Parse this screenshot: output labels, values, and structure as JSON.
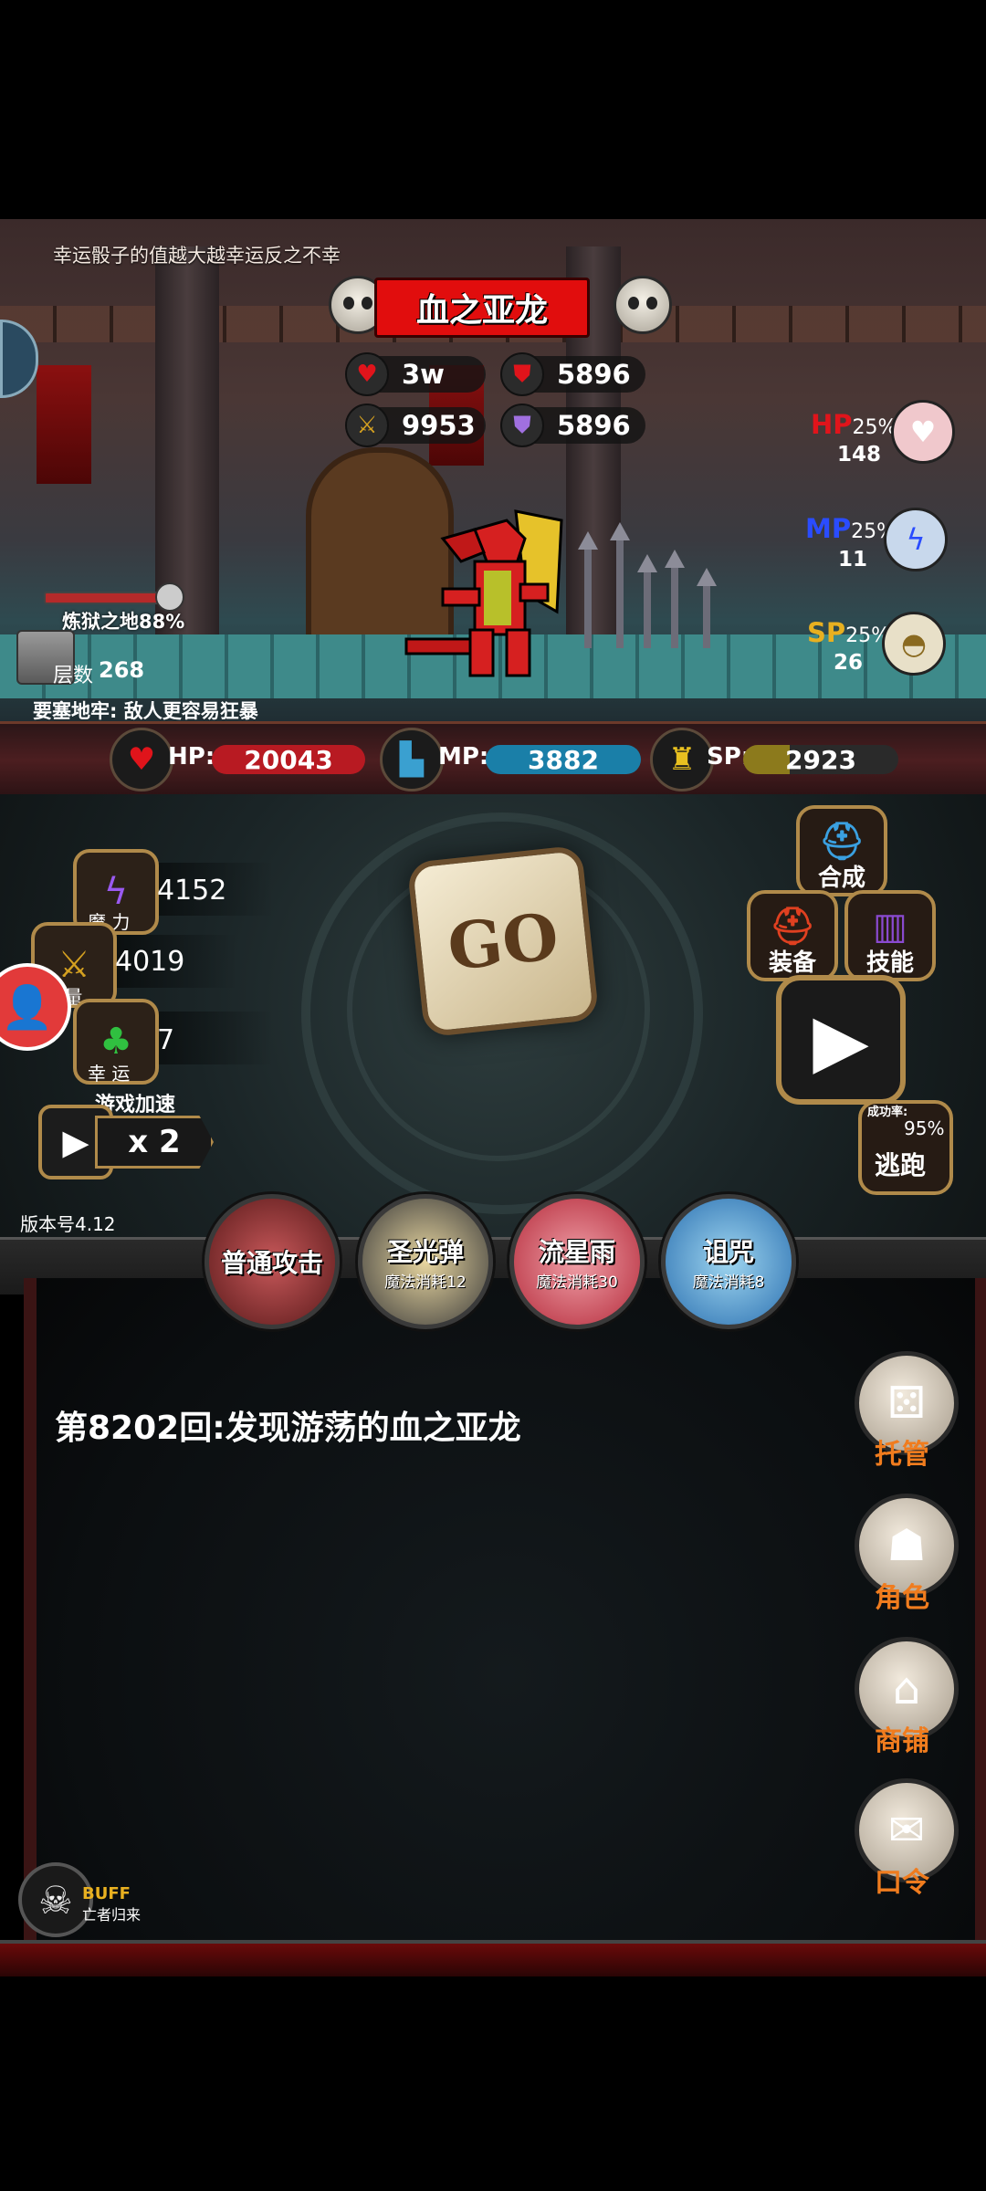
{
  "battle": {
    "tip": "幸运骰子的值越大越幸运反之不幸",
    "boss_name": "血之亚龙",
    "enemy_stats": {
      "hp": "3w",
      "defense": "5896",
      "attack": "9953",
      "magic_defense": "5896"
    },
    "floor": {
      "name": "炼狱之地88%",
      "count_label": "层数",
      "count": "268",
      "progress": 0.88
    },
    "fortress_note": "要塞地牢: 敌人更容易狂暴"
  },
  "potions": [
    {
      "label": "HP",
      "pct": "25%",
      "count": "148",
      "color": "#e0141b",
      "icon": "potion-heart-icon"
    },
    {
      "label": "MP",
      "pct": "25%",
      "count": "11",
      "color": "#2a4cff",
      "icon": "potion-lightning-icon"
    },
    {
      "label": "SP",
      "pct": "25%",
      "count": "26",
      "color": "#e8b020",
      "icon": "food-plate-icon"
    }
  ],
  "player": {
    "hp_label": "HP:",
    "hp": "20043",
    "mp_label": "MP:",
    "mp": "3882",
    "sp_label": "SP:",
    "sp": "2923",
    "colors": {
      "hp": "#b81a22",
      "mp": "#1a7fa8",
      "sp": "#8c7a1c"
    }
  },
  "attributes": [
    {
      "label": "魔 力",
      "value": "4152",
      "icon": "magic-bolt-icon"
    },
    {
      "label": "力 量",
      "value": "4019",
      "icon": "sword-icon"
    },
    {
      "label": "幸 运",
      "value": "7",
      "icon": "clover-icon"
    }
  ],
  "speed": {
    "label": "游戏加速",
    "value": "x 2"
  },
  "dice": {
    "text": "GO"
  },
  "actions": {
    "synth": "合成",
    "equip": "装备",
    "skill": "技能",
    "escape_rate_label": "成功率:",
    "escape_rate": "95%",
    "escape": "逃跑"
  },
  "version": "版本号4.12",
  "skills": [
    {
      "name": "普通攻击",
      "cost": "",
      "colors": [
        "#c7585a",
        "#5a1a1a"
      ],
      "icon": "sword-slash-icon"
    },
    {
      "name": "圣光弹",
      "cost": "魔法消耗12",
      "colors": [
        "#e8d6a0",
        "#3a3a3a"
      ],
      "icon": "holy-light-icon"
    },
    {
      "name": "流星雨",
      "cost": "魔法消耗30",
      "colors": [
        "#f0a0a8",
        "#b42a3a"
      ],
      "icon": "meteor-icon"
    },
    {
      "name": "诅咒",
      "cost": "魔法消耗8",
      "colors": [
        "#9fd6f0",
        "#2a6fb0"
      ],
      "icon": "curse-mask-icon"
    }
  ],
  "log": {
    "line": "第8202回:发现游荡的血之亚龙"
  },
  "side_buttons": [
    {
      "label": "托管",
      "icon": "dice-pair-icon"
    },
    {
      "label": "角色",
      "icon": "hooded-figure-icon"
    },
    {
      "label": "商铺",
      "icon": "shop-sign-icon"
    },
    {
      "label": "口令",
      "icon": "scroll-icon"
    }
  ],
  "buff": {
    "label": "BUFF",
    "name": "亡者归来"
  }
}
